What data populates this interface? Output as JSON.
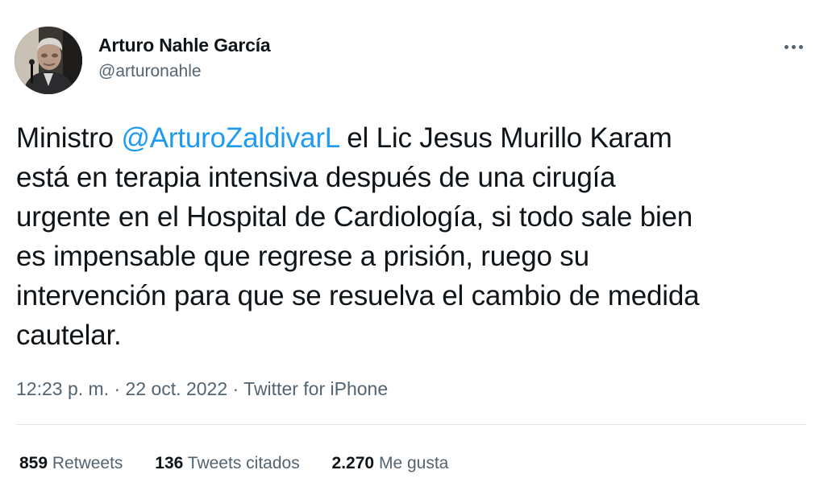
{
  "author": {
    "display_name": "Arturo Nahle García",
    "handle": "@arturonahle"
  },
  "menu": {
    "icon": "more-horizontal-icon"
  },
  "tweet": {
    "lines": [
      {
        "prefix": "Ministro ",
        "mention": "@ArturoZaldivarL",
        "suffix": " el Lic Jesus Murillo Karam"
      },
      {
        "text": "está en terapia intensiva después de una cirugía"
      },
      {
        "text": "urgente en el Hospital de Cardiología, si todo sale bien"
      },
      {
        "text": "es impensable que regrese a prisión, ruego su"
      },
      {
        "text": "intervención para que se resuelva el cambio de medida"
      },
      {
        "text": "cautelar."
      }
    ]
  },
  "meta": {
    "time": "12:23 p. m.",
    "sep1": " · ",
    "date": "22 oct. 2022",
    "sep2": " · ",
    "source": "Twitter for iPhone"
  },
  "stats": {
    "retweets": {
      "count": "859",
      "label": "Retweets"
    },
    "quotes": {
      "count": "136",
      "label": "Tweets citados"
    },
    "likes": {
      "count": "2.270",
      "label": "Me gusta"
    }
  },
  "colors": {
    "text": "#0f1419",
    "secondary": "#536471",
    "link": "#1d9bf0",
    "divider": "#e1e6ea"
  }
}
